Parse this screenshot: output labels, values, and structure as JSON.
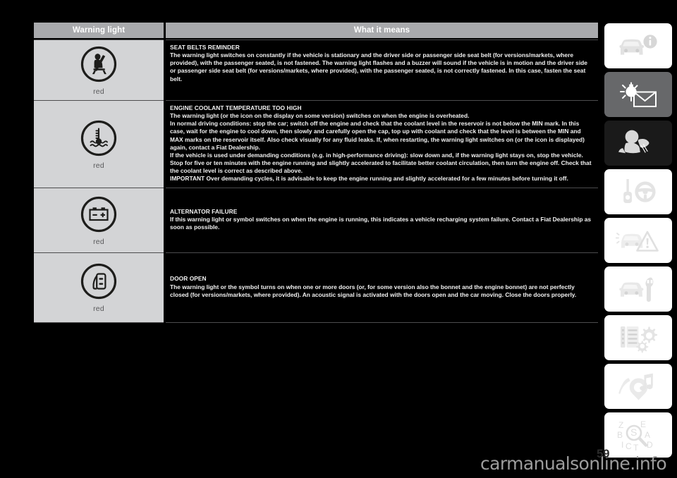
{
  "page": {
    "number": "59",
    "watermark": "carmanualsonline.info",
    "background_color": "#000000",
    "header_bg_color": "#a9aaad",
    "left_cell_bg_color": "#d3d4d6"
  },
  "table": {
    "headers": {
      "warning_light": "Warning light",
      "what_it_means": "What it means"
    },
    "rows": [
      {
        "icon_name": "seat-belt-reminder-icon",
        "colour": "red",
        "title": "SEAT BELTS REMINDER",
        "paragraphs": [
          "The warning light switches on constantly if the vehicle is stationary and the driver side or passenger side seat belt (for versions/markets, where provided), with the passenger seated, is not fastened. The warning light flashes and a buzzer will sound if the vehicle is in motion and the driver side or passenger side seat belt (for versions/markets, where provided), with the passenger seated, is not correctly fastened. In this case, fasten the seat belt."
        ]
      },
      {
        "icon_name": "engine-coolant-temperature-icon",
        "colour": "red",
        "title": "ENGINE COOLANT TEMPERATURE TOO HIGH",
        "paragraphs": [
          "The warning light (or the icon on the display on some version) switches on when the engine is overheated.",
          "In normal driving conditions: stop the car; switch off the engine and check that the coolant level in the reservoir is not below the MIN mark. In this case, wait for the engine to cool down, then slowly and carefully open the cap, top up with coolant and check that the level is between the MIN and MAX marks on the reservoir itself. Also check visually for any fluid leaks. If, when restarting, the warning light switches on (or the icon is displayed) again, contact a Fiat Dealership.",
          "If the vehicle is used under demanding conditions (e.g. in high-performance driving): slow down and, if the warning light stays on, stop the vehicle. Stop for five or ten minutes with the engine running and slightly accelerated to facilitate better coolant circulation, then turn the engine off. Check that the coolant level is correct as described above.",
          "IMPORTANT Over demanding cycles, it is advisable to keep the engine running and slightly accelerated for a few minutes before turning it off."
        ]
      },
      {
        "icon_name": "alternator-battery-icon",
        "colour": "red",
        "title": "ALTERNATOR FAILURE",
        "paragraphs": [
          "If this warning light or symbol switches on when the engine is running, this indicates a vehicle recharging system failure. Contact a Fiat Dealership as soon as possible."
        ]
      },
      {
        "icon_name": "door-open-icon",
        "colour": "red",
        "title": "DOOR OPEN",
        "paragraphs": [
          "The warning light or the symbol turns on when one or more doors (or, for some version also the bonnet and the engine bonnet) are not perfectly closed (for versions/markets, where provided). An acoustic signal is activated with the doors open and the car moving. Close the doors properly."
        ]
      }
    ]
  },
  "sidebar": {
    "tabs": [
      {
        "icon_name": "car-info-icon",
        "label": "dashboard-and-controls",
        "style": "white"
      },
      {
        "icon_name": "warning-lights-mail-icon",
        "label": "warning-lights-and-messages",
        "style": "grey"
      },
      {
        "icon_name": "airbag-safety-icon",
        "label": "safety",
        "style": "black"
      },
      {
        "icon_name": "key-steering-wheel-icon",
        "label": "starting-and-driving",
        "style": "white"
      },
      {
        "icon_name": "car-emergency-triangle-icon",
        "label": "in-an-emergency",
        "style": "white"
      },
      {
        "icon_name": "car-wrench-icon",
        "label": "maintenance-and-care",
        "style": "white"
      },
      {
        "icon_name": "specifications-gears-icon",
        "label": "technical-specifications",
        "style": "white"
      },
      {
        "icon_name": "multimedia-music-icon",
        "label": "multimedia",
        "style": "white"
      },
      {
        "icon_name": "alphabetical-index-icon",
        "label": "alphabetical-index",
        "style": "white"
      }
    ]
  }
}
